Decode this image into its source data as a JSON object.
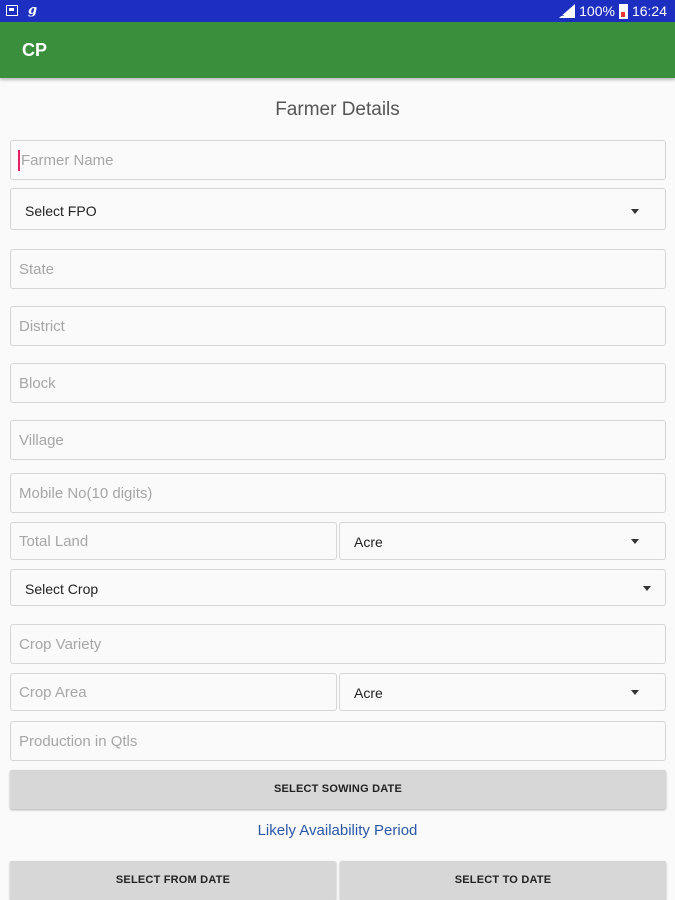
{
  "status_bar": {
    "battery_percent": "100%",
    "time": "16:24"
  },
  "app_bar": {
    "title": "CP"
  },
  "form": {
    "title": "Farmer Details",
    "farmer_name_placeholder": "Farmer Name",
    "fpo_select_value": "Select FPO",
    "state_placeholder": "State",
    "district_placeholder": "District",
    "block_placeholder": "Block",
    "village_placeholder": "Village",
    "mobile_placeholder": "Mobile No(10 digits)",
    "total_land_placeholder": "Total Land",
    "total_land_unit": "Acre",
    "crop_select_value": "Select Crop",
    "crop_variety_placeholder": "Crop Variety",
    "crop_area_placeholder": "Crop Area",
    "crop_area_unit": "Acre",
    "production_placeholder": "Production in Qtls",
    "sowing_date_button": "SELECT SOWING DATE",
    "availability_label": "Likely Availability Period",
    "from_date_button": "SELECT FROM DATE",
    "to_date_button": "SELECT TO DATE"
  },
  "colors": {
    "status_bar": "#1d2fc0",
    "app_bar": "#3a8f3c",
    "cursor": "#e91e63",
    "link_text": "#2a57a8",
    "button_bg": "#d7d7d7"
  }
}
